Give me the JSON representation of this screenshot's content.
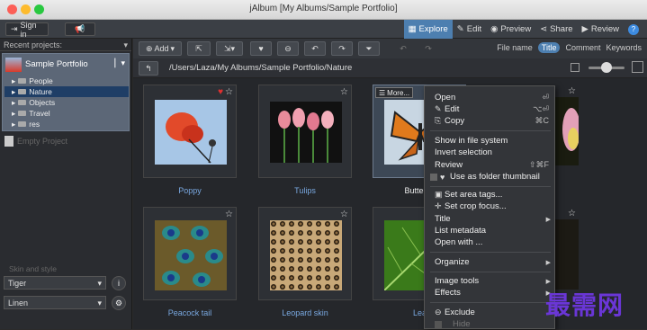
{
  "window": {
    "title": "jAlbum [My Albums/Sample Portfolio]"
  },
  "topbar": {
    "sign_in": "Sign in",
    "tabs": [
      {
        "label": "Explore",
        "icon": "grid-icon",
        "active": true
      },
      {
        "label": "Edit",
        "icon": "pencil-icon"
      },
      {
        "label": "Preview",
        "icon": "eye-icon"
      },
      {
        "label": "Share",
        "icon": "share-icon"
      },
      {
        "label": "Review",
        "icon": "play-icon"
      }
    ],
    "help": "?"
  },
  "sidebar": {
    "recent_label": "Recent projects:",
    "project_name": "Sample Portfolio",
    "folders": [
      "People",
      "Nature",
      "Objects",
      "Travel",
      "res"
    ],
    "selected_folder": "Nature",
    "empty_project": "Empty Project",
    "skin_label": "Skin and style",
    "skin": "Tiger",
    "style": "Linen",
    "info_btn": "i",
    "settings_btn": "⚙"
  },
  "toolbar": {
    "add": "Add",
    "view_options": [
      "File name",
      "Title",
      "Comment",
      "Keywords"
    ],
    "active_view": "Title"
  },
  "path": "/Users/Laza/My Albums/Sample Portfolio/Nature",
  "grid": {
    "items": [
      {
        "caption": "Poppy",
        "favorite": true
      },
      {
        "caption": "Tulips"
      },
      {
        "caption": "Butterfly",
        "selected": true
      },
      {
        "caption": ""
      },
      {
        "caption": "Peacock tail"
      },
      {
        "caption": "Leopard skin"
      },
      {
        "caption": "Leaf"
      },
      {
        "caption": ""
      }
    ],
    "more_label": "More..."
  },
  "context_menu": {
    "items": [
      {
        "label": "Open",
        "shortcut": "⏎"
      },
      {
        "label": "Edit",
        "shortcut": "⌥⏎",
        "icon": "✎"
      },
      {
        "label": "Copy",
        "shortcut": "⌘C",
        "icon": "⎘"
      },
      {
        "label": "Show in file system"
      },
      {
        "label": "Invert selection"
      },
      {
        "label": "Review",
        "shortcut": "⇧⌘F"
      },
      {
        "label": "Use as folder thumbnail",
        "icon": "♥"
      },
      {
        "label": "Set area tags...",
        "icon": "▣"
      },
      {
        "label": "Set crop focus...",
        "icon": "✛"
      },
      {
        "label": "Title",
        "submenu": true
      },
      {
        "label": "List metadata"
      },
      {
        "label": "Open with ..."
      },
      {
        "label": "Organize",
        "submenu": true
      },
      {
        "label": "Image tools",
        "submenu": true
      },
      {
        "label": "Effects",
        "submenu": true
      },
      {
        "label": "Exclude",
        "icon": "⊖"
      },
      {
        "label": "Hide"
      }
    ]
  },
  "watermark": "最需网"
}
